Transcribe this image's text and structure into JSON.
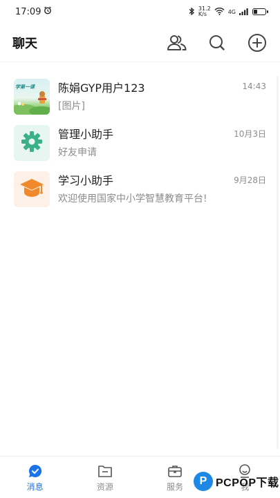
{
  "status_bar": {
    "time": "17:09",
    "speed_value": "31.2",
    "speed_unit": "K/s",
    "network": "4G"
  },
  "header": {
    "title": "聊天",
    "actions": [
      "contacts-icon",
      "search-icon",
      "add-icon"
    ]
  },
  "chats": [
    {
      "name": "陈娟GYP用户123",
      "preview": "[图片]",
      "time": "14:43",
      "avatar_text": "学第一课",
      "avatar_icon": "class-banner-icon"
    },
    {
      "name": "管理小助手",
      "preview": "好友申请",
      "time": "10月3日",
      "avatar_icon": "gear-icon",
      "accent": "#3cb08a"
    },
    {
      "name": "学习小助手",
      "preview": "欢迎使用国家中小学智慧教育平台!",
      "time": "9月28日",
      "avatar_icon": "graduation-cap-icon",
      "accent": "#f0892c"
    }
  ],
  "bottom_nav": [
    {
      "label": "消息",
      "icon": "message-icon",
      "active": true
    },
    {
      "label": "资源",
      "icon": "folder-icon",
      "active": false
    },
    {
      "label": "服务",
      "icon": "briefcase-icon",
      "active": false
    },
    {
      "label": "我",
      "icon": "person-icon",
      "active": false
    }
  ],
  "watermark": {
    "logo": "P",
    "text": "PCPOP下载"
  },
  "colors": {
    "accent": "#1a73e8",
    "text_primary": "#222222",
    "text_secondary": "#8c8c8c"
  }
}
